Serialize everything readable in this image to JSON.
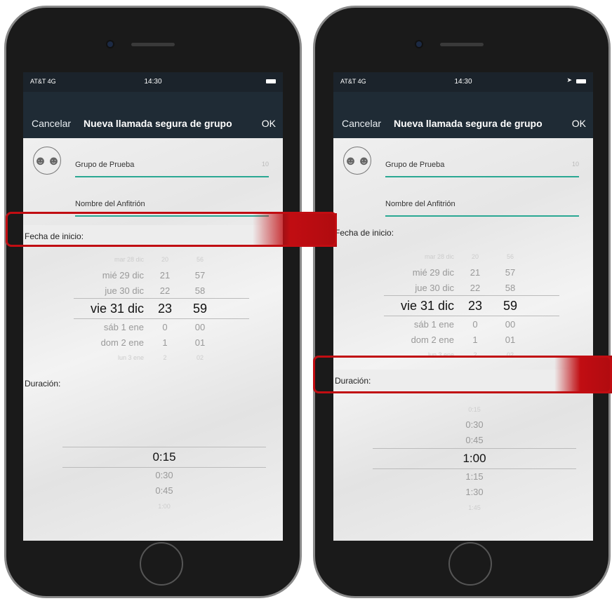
{
  "phones": [
    {
      "status": {
        "carrier": "AT&T 4G",
        "time": "14:30"
      },
      "nav": {
        "cancel": "Cancelar",
        "title": "Nueva llamada segura de grupo",
        "ok": "OK"
      },
      "group_field": {
        "value": "Grupo de Prueba",
        "counter": "10"
      },
      "host_field": {
        "value": "Nombre del Anfitrión"
      },
      "start_label": "Fecha de inicio:",
      "duration_label": "Duración:",
      "date_picker": [
        {
          "day": "mar 28 dic",
          "hour": "20",
          "minute": "56"
        },
        {
          "day": "mié 29 dic",
          "hour": "21",
          "minute": "57"
        },
        {
          "day": "jue 30 dic",
          "hour": "22",
          "minute": "58"
        },
        {
          "day": "vie 31 dic",
          "hour": "23",
          "minute": "59"
        },
        {
          "day": "sáb 1 ene",
          "hour": "0",
          "minute": "00"
        },
        {
          "day": "dom 2 ene",
          "hour": "1",
          "minute": "01"
        },
        {
          "day": "lun 3 ene",
          "hour": "2",
          "minute": "02"
        }
      ],
      "duration_picker": [
        "0:15",
        "0:30",
        "0:45",
        "1:00"
      ]
    },
    {
      "status": {
        "carrier": "AT&T 4G",
        "time": "14:30"
      },
      "nav": {
        "cancel": "Cancelar",
        "title": "Nueva llamada segura de grupo",
        "ok": "OK"
      },
      "group_field": {
        "value": "Grupo de Prueba",
        "counter": "10"
      },
      "host_field": {
        "value": "Nombre del Anfitrión"
      },
      "start_label": "Fecha de inicio:",
      "duration_label": "Duración:",
      "date_picker": [
        {
          "day": "mar 28 dic",
          "hour": "20",
          "minute": "56"
        },
        {
          "day": "mié 29 dic",
          "hour": "21",
          "minute": "57"
        },
        {
          "day": "jue 30 dic",
          "hour": "22",
          "minute": "58"
        },
        {
          "day": "vie 31 dic",
          "hour": "23",
          "minute": "59"
        },
        {
          "day": "sáb 1 ene",
          "hour": "0",
          "minute": "00"
        },
        {
          "day": "dom 2 ene",
          "hour": "1",
          "minute": "01"
        },
        {
          "day": "lun 3 ene",
          "hour": "2",
          "minute": "02"
        }
      ],
      "duration_picker": [
        "0:15",
        "0:30",
        "0:45",
        "1:00",
        "1:15",
        "1:30",
        "1:45"
      ]
    }
  ],
  "colors": {
    "accent": "#2aa893",
    "nav_bg": "#1f2b35",
    "callout": "#c10d12"
  }
}
